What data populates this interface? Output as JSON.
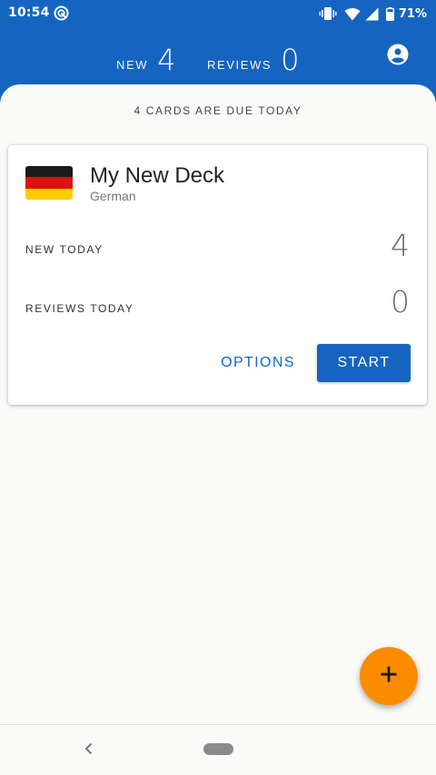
{
  "status_bar": {
    "time": "10:54",
    "battery": "71%",
    "app_icon": "sync-icon"
  },
  "header": {
    "new_label": "NEW",
    "new_count": "4",
    "reviews_label": "REVIEWS",
    "reviews_count": "0",
    "account_icon": "account-circle-icon"
  },
  "main": {
    "due_text": "4 CARDS ARE DUE TODAY"
  },
  "deck_card": {
    "title": "My New Deck",
    "language": "German",
    "flag_colors": [
      "#1a1a1a",
      "#dd1111",
      "#ffcc00"
    ],
    "new_today_label": "NEW TODAY",
    "new_today_value": "4",
    "reviews_today_label": "REVIEWS TODAY",
    "reviews_today_value": "0",
    "options_label": "OPTIONS",
    "start_label": "START"
  },
  "fab": {
    "icon": "plus-icon",
    "color": "#fb8c00"
  },
  "colors": {
    "primary": "#1565c0",
    "accent": "#fb8c00",
    "background": "#fafaf9"
  },
  "nav": {
    "back_icon": "back-chevron-icon",
    "home_icon": "home-pill-icon"
  }
}
